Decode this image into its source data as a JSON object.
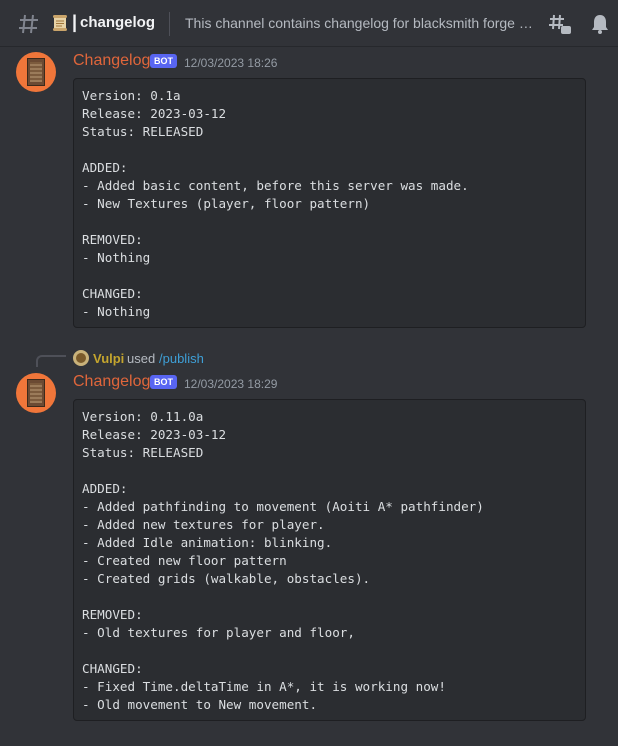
{
  "header": {
    "pipe": "|",
    "channel_name": "changelog",
    "topic": "This channel contains changelog for blacksmith forge ga..."
  },
  "messages": [
    {
      "author": "Changelog",
      "bot_tag": "BOT",
      "timestamp": "12/03/2023 18:26",
      "code": "Version: 0.1a\nRelease: 2023-03-12\nStatus: RELEASED\n\nADDED:\n- Added basic content, before this server was made.\n- New Textures (player, floor pattern)\n\nREMOVED:\n- Nothing\n\nCHANGED:\n- Nothing"
    },
    {
      "command": {
        "user": "Vulpi",
        "used": "used",
        "name": "/publish"
      },
      "author": "Changelog",
      "bot_tag": "BOT",
      "timestamp": "12/03/2023 18:29",
      "code": "Version: 0.11.0a\nRelease: 2023-03-12\nStatus: RELEASED\n\nADDED:\n- Added pathfinding to movement (Aoiti A* pathfinder)\n- Added new textures for player.\n- Added Idle animation: blinking.\n- Created new floor pattern\n- Created grids (walkable, obstacles).\n\nREMOVED:\n- Old textures for player and floor,\n\nCHANGED:\n- Fixed Time.deltaTime in A*, it is working now!\n- Old movement to New movement."
    }
  ],
  "colors": {
    "background": "#313338",
    "username": "#e0663b",
    "bot_tag": "#5865f2",
    "command_user": "#c4a52e",
    "command_name": "#3e9fd6"
  },
  "icons": [
    "hashtag-icon",
    "scroll-icon",
    "threads-icon",
    "bell-icon"
  ]
}
